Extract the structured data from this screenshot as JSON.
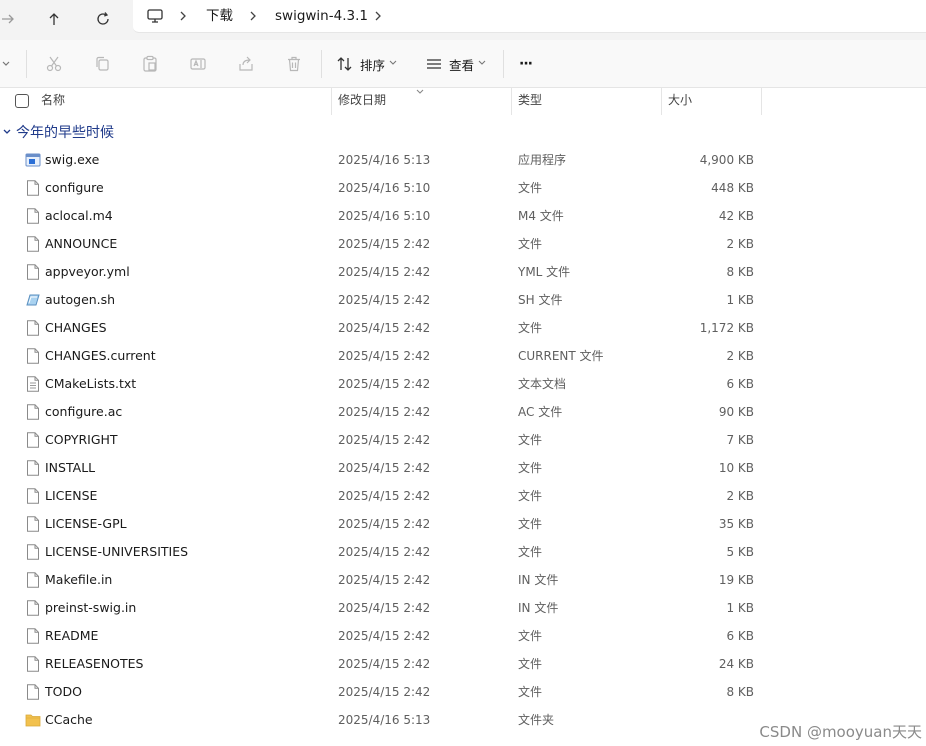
{
  "breadcrumb": {
    "items": [
      "下载",
      "swigwin-4.3.1"
    ]
  },
  "toolbar": {
    "sort_label": "排序",
    "view_label": "查看",
    "more_label": "···"
  },
  "columns": {
    "name": "名称",
    "date": "修改日期",
    "type": "类型",
    "size": "大小"
  },
  "group": {
    "label": "今年的早些时候"
  },
  "files": [
    {
      "name": "swig.exe",
      "date": "2025/4/16 5:13",
      "type": "应用程序",
      "size": "4,900 KB",
      "icon": "exe-icon"
    },
    {
      "name": "configure",
      "date": "2025/4/16 5:10",
      "type": "文件",
      "size": "448 KB",
      "icon": "file-icon"
    },
    {
      "name": "aclocal.m4",
      "date": "2025/4/16 5:10",
      "type": "M4 文件",
      "size": "42 KB",
      "icon": "file-icon"
    },
    {
      "name": "ANNOUNCE",
      "date": "2025/4/15 2:42",
      "type": "文件",
      "size": "2 KB",
      "icon": "file-icon"
    },
    {
      "name": "appveyor.yml",
      "date": "2025/4/15 2:42",
      "type": "YML 文件",
      "size": "8 KB",
      "icon": "file-icon"
    },
    {
      "name": "autogen.sh",
      "date": "2025/4/15 2:42",
      "type": "SH 文件",
      "size": "1 KB",
      "icon": "script-icon"
    },
    {
      "name": "CHANGES",
      "date": "2025/4/15 2:42",
      "type": "文件",
      "size": "1,172 KB",
      "icon": "file-icon"
    },
    {
      "name": "CHANGES.current",
      "date": "2025/4/15 2:42",
      "type": "CURRENT 文件",
      "size": "2 KB",
      "icon": "file-icon"
    },
    {
      "name": "CMakeLists.txt",
      "date": "2025/4/15 2:42",
      "type": "文本文档",
      "size": "6 KB",
      "icon": "text-file-icon"
    },
    {
      "name": "configure.ac",
      "date": "2025/4/15 2:42",
      "type": "AC 文件",
      "size": "90 KB",
      "icon": "file-icon"
    },
    {
      "name": "COPYRIGHT",
      "date": "2025/4/15 2:42",
      "type": "文件",
      "size": "7 KB",
      "icon": "file-icon"
    },
    {
      "name": "INSTALL",
      "date": "2025/4/15 2:42",
      "type": "文件",
      "size": "10 KB",
      "icon": "file-icon"
    },
    {
      "name": "LICENSE",
      "date": "2025/4/15 2:42",
      "type": "文件",
      "size": "2 KB",
      "icon": "file-icon"
    },
    {
      "name": "LICENSE-GPL",
      "date": "2025/4/15 2:42",
      "type": "文件",
      "size": "35 KB",
      "icon": "file-icon"
    },
    {
      "name": "LICENSE-UNIVERSITIES",
      "date": "2025/4/15 2:42",
      "type": "文件",
      "size": "5 KB",
      "icon": "file-icon"
    },
    {
      "name": "Makefile.in",
      "date": "2025/4/15 2:42",
      "type": "IN 文件",
      "size": "19 KB",
      "icon": "file-icon"
    },
    {
      "name": "preinst-swig.in",
      "date": "2025/4/15 2:42",
      "type": "IN 文件",
      "size": "1 KB",
      "icon": "file-icon"
    },
    {
      "name": "README",
      "date": "2025/4/15 2:42",
      "type": "文件",
      "size": "6 KB",
      "icon": "file-icon"
    },
    {
      "name": "RELEASENOTES",
      "date": "2025/4/15 2:42",
      "type": "文件",
      "size": "24 KB",
      "icon": "file-icon"
    },
    {
      "name": "TODO",
      "date": "2025/4/15 2:42",
      "type": "文件",
      "size": "8 KB",
      "icon": "file-icon"
    },
    {
      "name": "CCache",
      "date": "2025/4/16 5:13",
      "type": "文件夹",
      "size": "",
      "icon": "folder-icon"
    }
  ],
  "watermark": "CSDN @mooyuan天天",
  "colors": {
    "group_header": "#1f3a8a",
    "folder": "#f2c14e",
    "exe_accent": "#2b6fd6"
  }
}
